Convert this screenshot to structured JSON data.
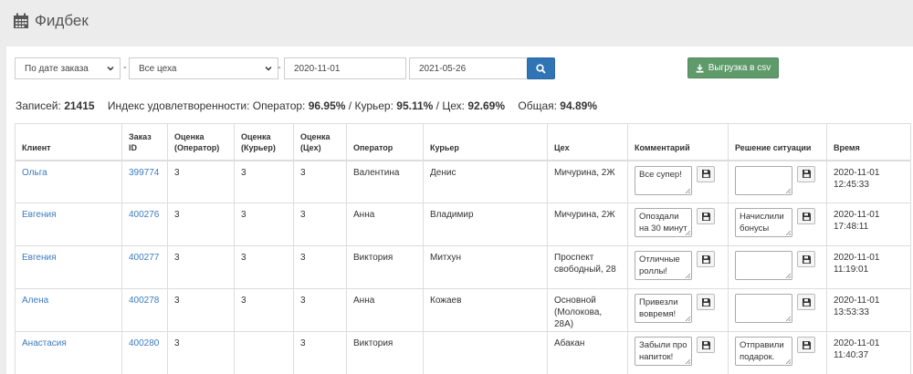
{
  "page": {
    "title": "Фидбек"
  },
  "filters": {
    "date_mode": "По дате заказа",
    "shop": "Все цеха",
    "date_from": "2020-11-01",
    "date_to": "2021-05-26",
    "dash": "-",
    "export_label": "Выгрузка в csv"
  },
  "stats": {
    "records_label": "Записей:",
    "records_value": "21415",
    "index_label": "Индекс удовлетворенности: Оператор:",
    "operator_value": "96.95%",
    "courier_label": "/ Курьер:",
    "courier_value": "95.11%",
    "shop_label": "/ Цех:",
    "shop_value": "92.69%",
    "total_label": "Общая:",
    "total_value": "94.89%"
  },
  "table": {
    "headers": [
      "Клиент",
      "Заказ ID",
      "Оценка (Оператор)",
      "Оценка (Курьер)",
      "Оценка (Цех)",
      "Оператор",
      "Курьер",
      "Цех",
      "Комментарий",
      "Решение ситуации",
      "Время"
    ],
    "rows": [
      {
        "client": "Ольга",
        "order": "399774",
        "op_score": "3",
        "cour_score": "3",
        "shop_score": "3",
        "operator": "Валентина",
        "courier": "Денис",
        "shop": "Мичурина, 2Ж",
        "comment": "Все супер!",
        "resolution": "",
        "time": "2020-11-01 12:45:33"
      },
      {
        "client": "Евгения",
        "order": "400276",
        "op_score": "3",
        "cour_score": "3",
        "shop_score": "3",
        "operator": "Анна",
        "courier": "Владимир",
        "shop": "Мичурина, 2Ж",
        "comment": "Опоздали на 30 минут",
        "resolution": "Начислили бонусы",
        "time": "2020-11-01 17:48:11"
      },
      {
        "client": "Евгения",
        "order": "400277",
        "op_score": "3",
        "cour_score": "3",
        "shop_score": "3",
        "operator": "Виктория",
        "courier": "Митхун",
        "shop": "Проспект свободный, 28",
        "comment": "Отличные роллы!",
        "resolution": "",
        "time": "2020-11-01 11:19:01"
      },
      {
        "client": "Алена",
        "order": "400278",
        "op_score": "3",
        "cour_score": "3",
        "shop_score": "3",
        "operator": "Анна",
        "courier": "Кожаев",
        "shop": "Основной (Молокова, 28А)",
        "comment": "Привезли вовремя!",
        "resolution": "",
        "time": "2020-11-01 13:53:33"
      },
      {
        "client": "Анастасия",
        "order": "400280",
        "op_score": "3",
        "cour_score": "",
        "shop_score": "3",
        "operator": "Виктория",
        "courier": "",
        "shop": "Абакан",
        "comment": "Забыли про напиток!",
        "resolution": "Отправили подарок.",
        "time": "2020-11-01 11:40:37"
      }
    ]
  }
}
